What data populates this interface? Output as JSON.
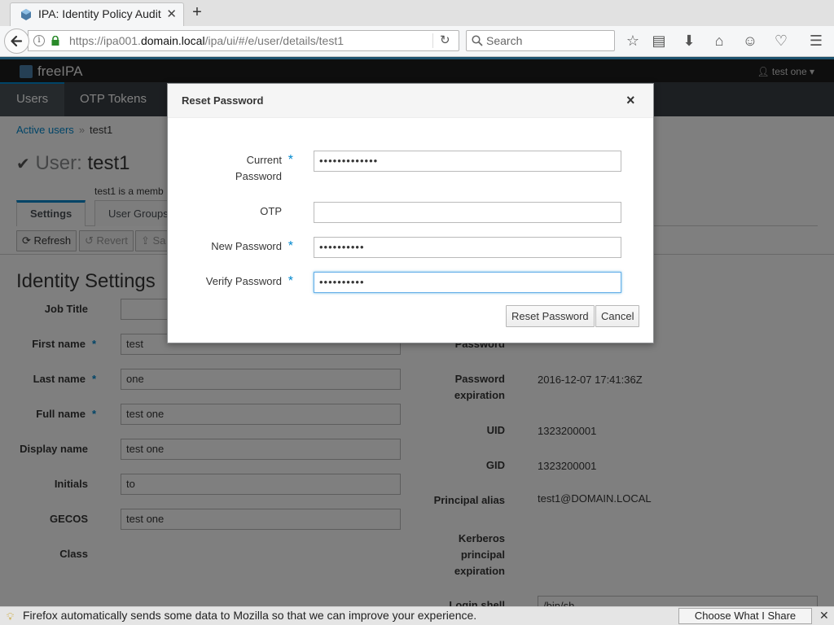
{
  "browser": {
    "tab_title": "IPA: Identity Policy Audit",
    "tab_close": "✕",
    "new_tab": "+",
    "url_prefix": "https://ipa001.",
    "url_host": "domain.local",
    "url_path": "/ipa/ui/#/e/user/details/test1",
    "search_placeholder": "Search"
  },
  "app": {
    "logo_text": "freeIPA",
    "user_menu": "test one",
    "nav": {
      "users": "Users",
      "otp_tokens": "OTP Tokens"
    },
    "breadcrumb": {
      "parent": "Active users",
      "current": "test1"
    },
    "title_label": "User:",
    "title_value": "test1",
    "member_note": "test1 is a memb",
    "tabs": {
      "settings": "Settings",
      "user_groups": "User Groups"
    },
    "actions": {
      "refresh": "Refresh",
      "revert": "Revert",
      "save": "Sa"
    },
    "section_title": "Identity Settings",
    "left_fields": {
      "job_title": {
        "label": "Job Title",
        "value": ""
      },
      "first_name": {
        "label": "First name",
        "value": "test"
      },
      "last_name": {
        "label": "Last name",
        "value": "one"
      },
      "full_name": {
        "label": "Full name",
        "value": "test one"
      },
      "display_name": {
        "label": "Display name",
        "value": "test one"
      },
      "initials": {
        "label": "Initials",
        "value": "to"
      },
      "gecos": {
        "label": "GECOS",
        "value": "test one"
      },
      "class": {
        "label": "Class",
        "value": ""
      }
    },
    "right_fields": {
      "password": {
        "label": "Password",
        "value": "******"
      },
      "password_expiration": {
        "label": "Password expiration",
        "value": "2016-12-07 17:41:36Z"
      },
      "uid": {
        "label": "UID",
        "value": "1323200001"
      },
      "gid": {
        "label": "GID",
        "value": "1323200001"
      },
      "principal_alias": {
        "label": "Principal alias",
        "value": "test1@DOMAIN.LOCAL"
      },
      "kerberos_expiration": {
        "label": "Kerberos principal expiration",
        "value": ""
      },
      "login_shell": {
        "label": "Login shell",
        "value": "/bin/sh"
      }
    },
    "required_mark": "*"
  },
  "modal": {
    "title": "Reset Password",
    "close": "×",
    "current_password": {
      "label": "Current Password",
      "value": "•••••••••••••"
    },
    "otp": {
      "label": "OTP",
      "value": ""
    },
    "new_password": {
      "label": "New Password",
      "value": "••••••••••"
    },
    "verify_password": {
      "label": "Verify Password",
      "value": "••••••••••"
    },
    "reset_button": "Reset Password",
    "cancel_button": "Cancel"
  },
  "notification": {
    "text": "Firefox automatically sends some data to Mozilla so that we can improve your experience.",
    "button": "Choose What I Share",
    "close": "✕"
  },
  "colors": {
    "accent": "#0088ce",
    "nav_bg": "#393f44",
    "header_bg": "#1d1d1d"
  }
}
